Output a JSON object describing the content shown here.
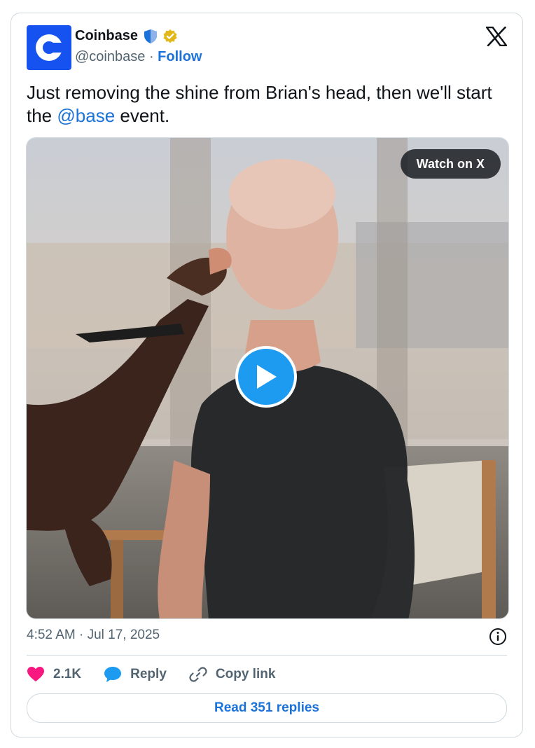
{
  "account": {
    "display_name": "Coinbase",
    "handle": "@coinbase",
    "separator": "·",
    "follow_label": "Follow"
  },
  "tweet": {
    "text_before": "Just removing the shine from Brian's head, then we'll start the ",
    "mention": "@base",
    "text_after": " event."
  },
  "media": {
    "watch_label": "Watch on X"
  },
  "meta": {
    "timestamp": "4:52 AM · Jul 17, 2025"
  },
  "actions": {
    "like_count": "2.1K",
    "reply_label": "Reply",
    "copy_link_label": "Copy link"
  },
  "read_replies_label": "Read 351 replies",
  "icons": {
    "x_logo": "x-logo-icon",
    "info": "info-icon",
    "heart": "heart-icon",
    "reply": "speech-bubble-icon",
    "link": "link-icon",
    "play": "play-icon"
  },
  "colors": {
    "brand_blue": "#1652f0",
    "link_blue": "#1b72d8",
    "like_pink": "#f91880",
    "muted_text": "#536471"
  }
}
